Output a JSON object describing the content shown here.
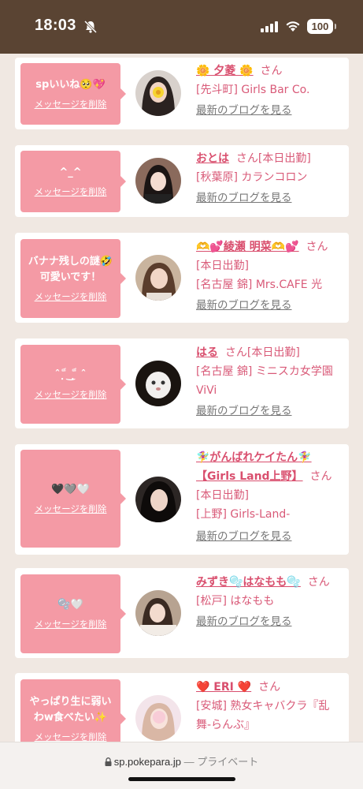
{
  "status": {
    "time": "18:03",
    "battery": "100"
  },
  "delete_label": "メッセージを削除",
  "blog_label": "最新のブログを見る",
  "san_label": "さん",
  "messages": [
    {
      "message": "spいいね🥺💖",
      "name": "🌼 夕菱 🌼",
      "suffix": "",
      "area": "[先斗町] Girls Bar Co.",
      "area2": ""
    },
    {
      "message": "^_^",
      "name": "おとは",
      "suffix": "[本日出勤]",
      "area": "[秋葉原] カランコロン",
      "area2": ""
    },
    {
      "message": "バナナ残しの謎🤣\n可愛いです！",
      "name": "🫶💕綾瀬 明菜🫶💕",
      "suffix": "[本日出勤]",
      "area": "[名古屋 錦] Mrs.CAFE 光",
      "area2": ""
    },
    {
      "message": "ˆ ฺ ็ ͜ ฺ ็ ˆ",
      "name": "はる",
      "suffix": "[本日出勤]",
      "area": "[名古屋 錦] ミニスカ女学園",
      "area2": "ViVi"
    },
    {
      "message": "🖤🩶🤍",
      "name": "🧚‍♀️がんばれケイたん🧚‍♀️【Girls Land上野】",
      "suffix": "",
      "area": "[本日出勤]",
      "area2": "[上野] Girls-Land-"
    },
    {
      "message": "🫧🤍",
      "name": "みずき🫧はなもも🫧",
      "suffix": "",
      "area": "[松戸] はなもも",
      "area2": ""
    },
    {
      "message": "やっぱり生に弱い\nわw食べたい✨",
      "name": "❤️ ERI ❤️",
      "suffix": "",
      "area": "[安城] 熟女キャバクラ『乱",
      "area2": "舞-らんぶ』"
    }
  ],
  "url_bar": {
    "domain": "sp.pokepara.jp",
    "separator": "—",
    "mode": "プライベート"
  },
  "colors": {
    "status_bg": "#5a4433",
    "bubble": "#f49aa5",
    "name": "#d94f6e",
    "page_bg": "#f0e8e2"
  }
}
